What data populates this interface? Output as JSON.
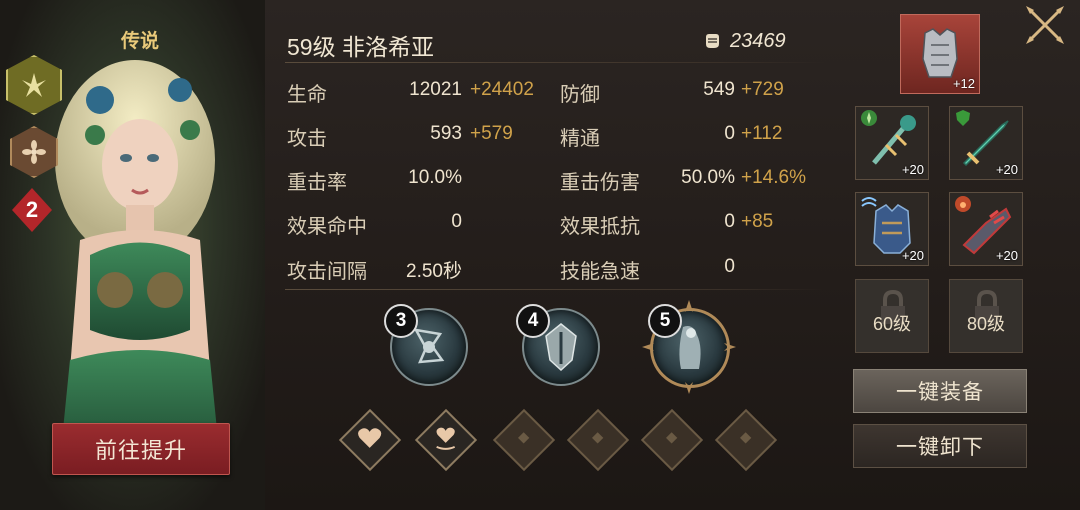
{
  "hero": {
    "rarity": "传说",
    "star_level": "2",
    "upgrade_button": "前往提升",
    "name": "59级  非洛希亚",
    "power": "23469"
  },
  "stats": [
    {
      "left_label": "生命",
      "left_base": "12021",
      "left_bonus": "+24402",
      "right_label": "防御",
      "right_base": "549",
      "right_bonus": "+729"
    },
    {
      "left_label": "攻击",
      "left_base": "593",
      "left_bonus": "+579",
      "right_label": "精通",
      "right_base": "0",
      "right_bonus": "+112"
    },
    {
      "left_label": "重击率",
      "left_base": "10.0%",
      "left_bonus": "",
      "right_label": "重击伤害",
      "right_base": "50.0%",
      "right_bonus": "+14.6%"
    },
    {
      "left_label": "效果命中",
      "left_base": "0",
      "left_bonus": "",
      "right_label": "效果抵抗",
      "right_base": "0",
      "right_bonus": "+85"
    },
    {
      "left_label": "攻击间隔",
      "left_base": "2.50秒",
      "left_bonus": "",
      "right_label": "技能急速",
      "right_base": "0",
      "right_bonus": ""
    }
  ],
  "skills": [
    {
      "level": "3",
      "icon": "rune-skill-icon"
    },
    {
      "level": "4",
      "icon": "crest-skill-icon"
    },
    {
      "level": "5",
      "icon": "spirit-ultimate-icon"
    }
  ],
  "runes": [
    "heart-filled",
    "heart-glow",
    "empty",
    "empty",
    "empty",
    "empty"
  ],
  "equipment": {
    "armor_level": "+12",
    "slots": [
      {
        "name": "weapon-staff",
        "level": "+20"
      },
      {
        "name": "weapon-dagger",
        "level": "+20"
      },
      {
        "name": "chest-armor",
        "level": "+20"
      },
      {
        "name": "gauntlet",
        "level": "+20"
      }
    ],
    "locked_slots": [
      "60级",
      "80级"
    ],
    "equip_all_button": "一键装备",
    "unequip_all_button": "一键卸下"
  },
  "colors": {
    "bonus": "#d0a24a",
    "accent_red": "#9a2c2f",
    "gold": "#e9c97a"
  }
}
